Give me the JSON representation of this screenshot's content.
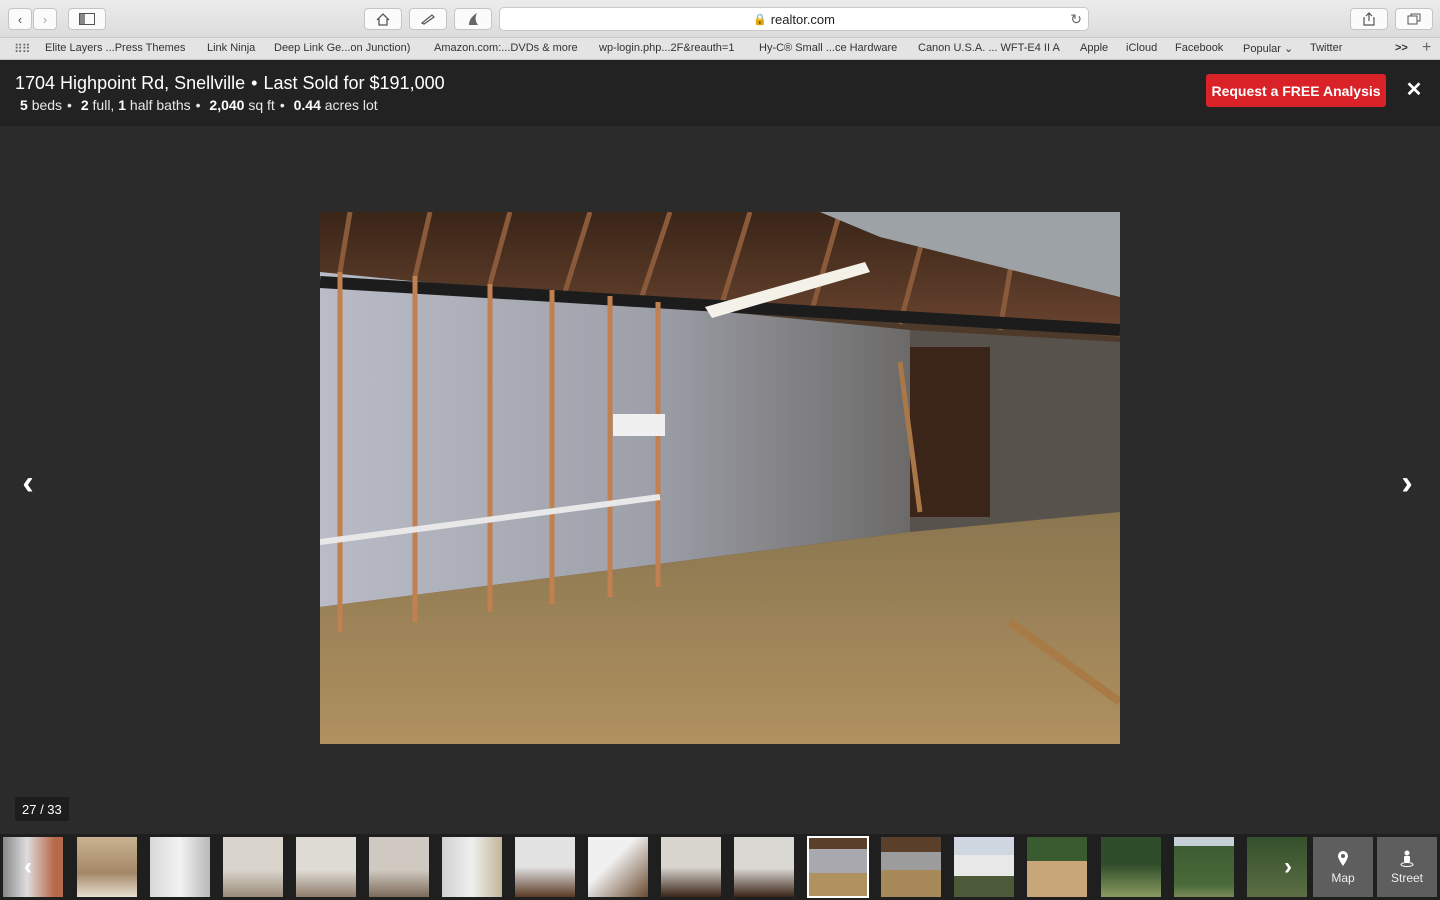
{
  "browser": {
    "url": "realtor.com",
    "bookmarks": [
      "Elite Layers ...Press Themes",
      "Link Ninja",
      "Deep Link Ge...on Junction)",
      "Amazon.com:...DVDs & more",
      "wp-login.php...2F&reauth=1",
      "Hy-C® Small ...ce Hardware",
      "Canon U.S.A. ... WFT-E4 II A",
      "Apple",
      "iCloud",
      "Facebook",
      "Popular",
      "Twitter"
    ],
    "overflow_label": ">>"
  },
  "listing": {
    "address": "1704 Highpoint Rd, Snellville",
    "sold": "Last Sold for $191,000",
    "beds_num": "5",
    "beds_label": "beds",
    "full_baths_num": "2",
    "full_label": "full,",
    "half_baths_num": "1",
    "half_label": "half baths",
    "sqft_num": "2,040",
    "sqft_label": "sq ft",
    "lot_num": "0.44",
    "lot_label": "acres lot",
    "separator": "•",
    "cta_label": "Request a FREE Analysis",
    "close_glyph": "✕"
  },
  "viewer": {
    "counter": "27 / 33",
    "prev_glyph": "‹",
    "next_glyph": "›"
  },
  "filmstrip": {
    "prev_glyph": "‹",
    "next_glyph": "›",
    "map_label": "Map",
    "street_label": "Street"
  }
}
